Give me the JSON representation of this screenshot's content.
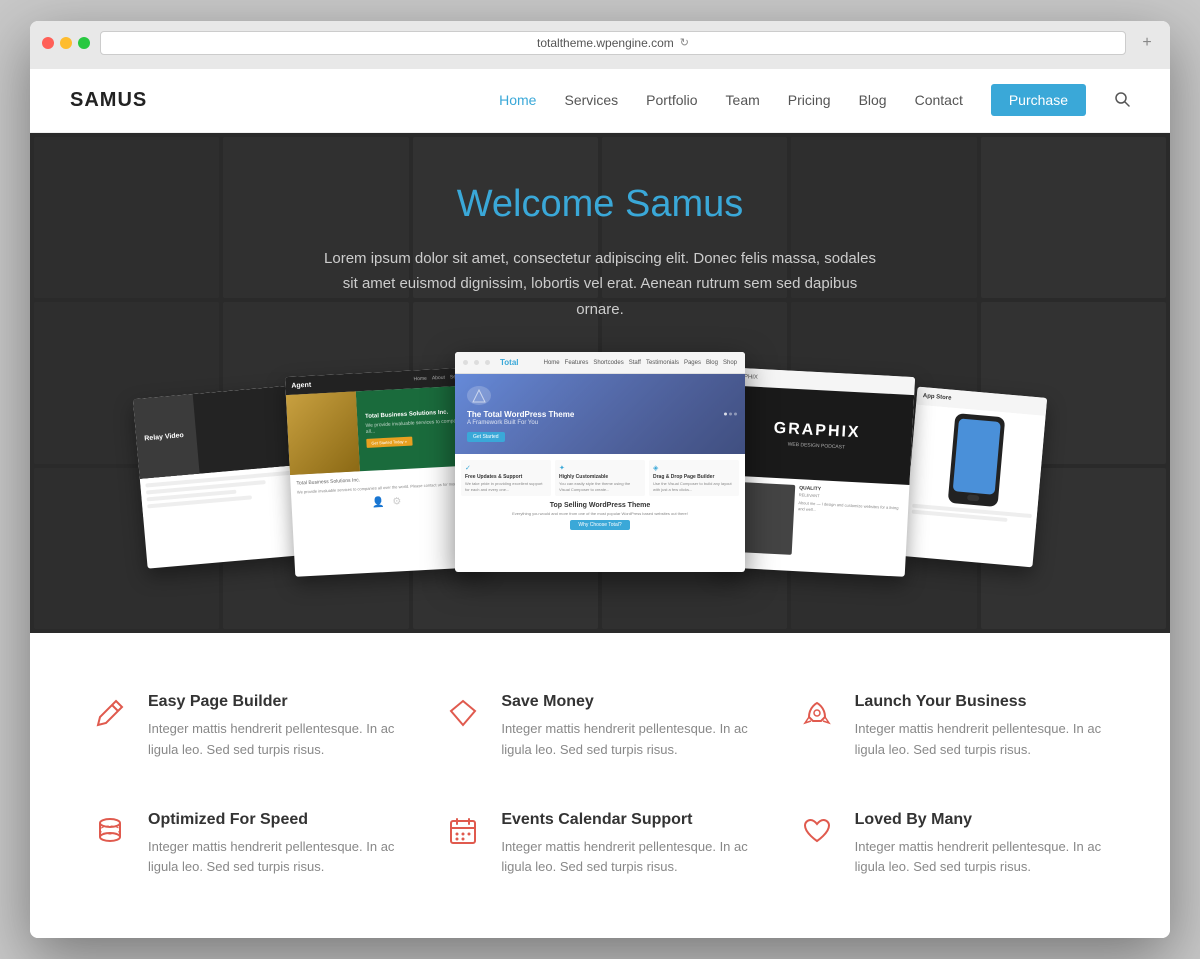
{
  "browser": {
    "address": "totaltheme.wpengine.com",
    "refresh_label": "↻"
  },
  "header": {
    "logo": "SAMUS",
    "nav": {
      "home": "Home",
      "services": "Services",
      "portfolio": "Portfolio",
      "team": "Team",
      "pricing": "Pricing",
      "blog": "Blog",
      "contact": "Contact",
      "purchase": "Purchase"
    }
  },
  "hero": {
    "title": "Welcome Samus",
    "subtitle": "Lorem ipsum dolor sit amet, consectetur adipiscing elit. Donec felis massa, sodales sit amet euismod dignissim, lobortis vel erat. Aenean rutrum sem sed dapibus ornare."
  },
  "features": [
    {
      "id": "easy-page-builder",
      "title": "Easy Page Builder",
      "desc": "Integer mattis hendrerit pellentesque. In ac ligula leo. Sed sed turpis risus.",
      "icon": "pencil"
    },
    {
      "id": "save-money",
      "title": "Save Money",
      "desc": "Integer mattis hendrerit pellentesque. In ac ligula leo. Sed sed turpis risus.",
      "icon": "diamond"
    },
    {
      "id": "launch-business",
      "title": "Launch Your Business",
      "desc": "Integer mattis hendrerit pellentesque. In ac ligula leo. Sed sed turpis risus.",
      "icon": "rocket"
    },
    {
      "id": "optimized-speed",
      "title": "Optimized For Speed",
      "desc": "Integer mattis hendrerit pellentesque. In ac ligula leo. Sed sed turpis risus.",
      "icon": "cylinder"
    },
    {
      "id": "events-calendar",
      "title": "Events Calendar Support",
      "desc": "Integer mattis hendrerit pellentesque. In ac ligula leo. Sed sed turpis risus.",
      "icon": "calendar"
    },
    {
      "id": "loved-by-many",
      "title": "Loved By Many",
      "desc": "Integer mattis hendrerit pellentesque. In ac ligula leo. Sed sed turpis risus.",
      "icon": "heart"
    }
  ],
  "screenshots": {
    "main_header_logo": "Total",
    "main_hero_title": "The Total WordPress Theme",
    "main_hero_subtitle": "A Framework Built For You",
    "main_bottom_title": "Top Selling WordPress Theme",
    "main_bottom_text": "Everything you would and more from one of the most popular WordPress based websites out there!",
    "left1_brand": "Agent",
    "left1_title": "Total Business Solutions Inc.",
    "left1_sub": "We provide invaluable services to companies all...",
    "right1_brand": "GRAPHIX",
    "right1_tagline": "WEB DESIGN PODCAST"
  }
}
